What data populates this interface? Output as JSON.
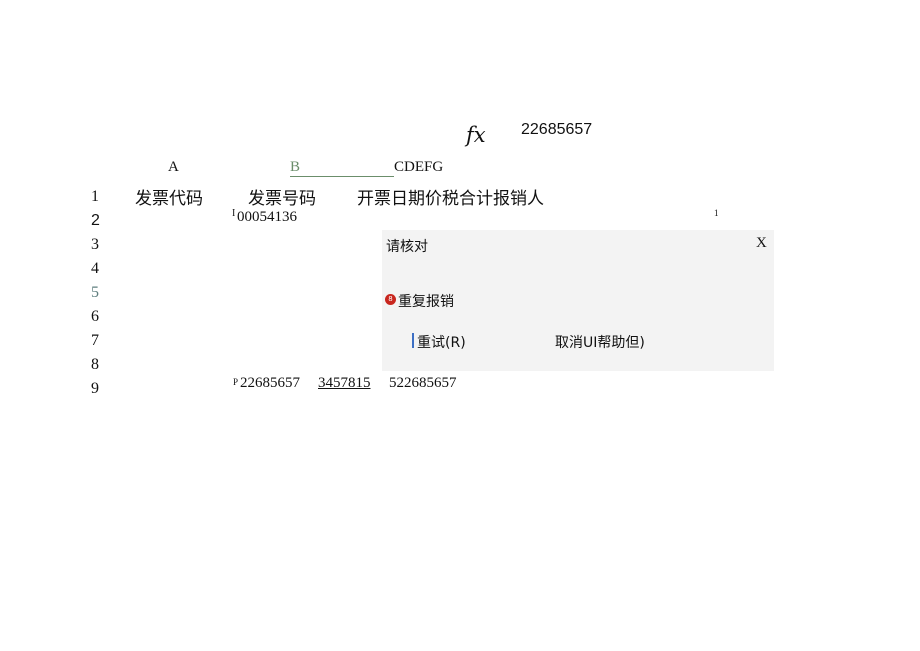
{
  "formula_bar": {
    "fx_label": "fx",
    "value": "22685657"
  },
  "columns": {
    "a": "A",
    "b": "B",
    "rest": "CDEFG"
  },
  "rows": [
    "1",
    "2",
    "3",
    "4",
    "5",
    "6",
    "7",
    "8",
    "9"
  ],
  "row_colors": {
    "5": "#5f7f7f"
  },
  "header_row": {
    "invoice_code": "发票代码",
    "invoice_number": "发票号码",
    "rest": "开票日期价税合计报销人"
  },
  "row2": {
    "prefix": "I",
    "invoice_number": "00054136",
    "marker": "1"
  },
  "row9": {
    "prefix": "P",
    "value_a": "22685657",
    "value_b": "3457815",
    "value_c": "522685657"
  },
  "dialog": {
    "title": "请核对",
    "close_label": "X",
    "error_icon_glyph": "8",
    "message": "重复报销",
    "retry_label": "重试(R)",
    "cancel_help_label": "取消UI帮助但)"
  },
  "colors": {
    "error_icon": "#c8261e",
    "dialog_bg": "#f3f3f3",
    "column_b": "#6b8e6b",
    "caret": "#3c6fc4"
  }
}
